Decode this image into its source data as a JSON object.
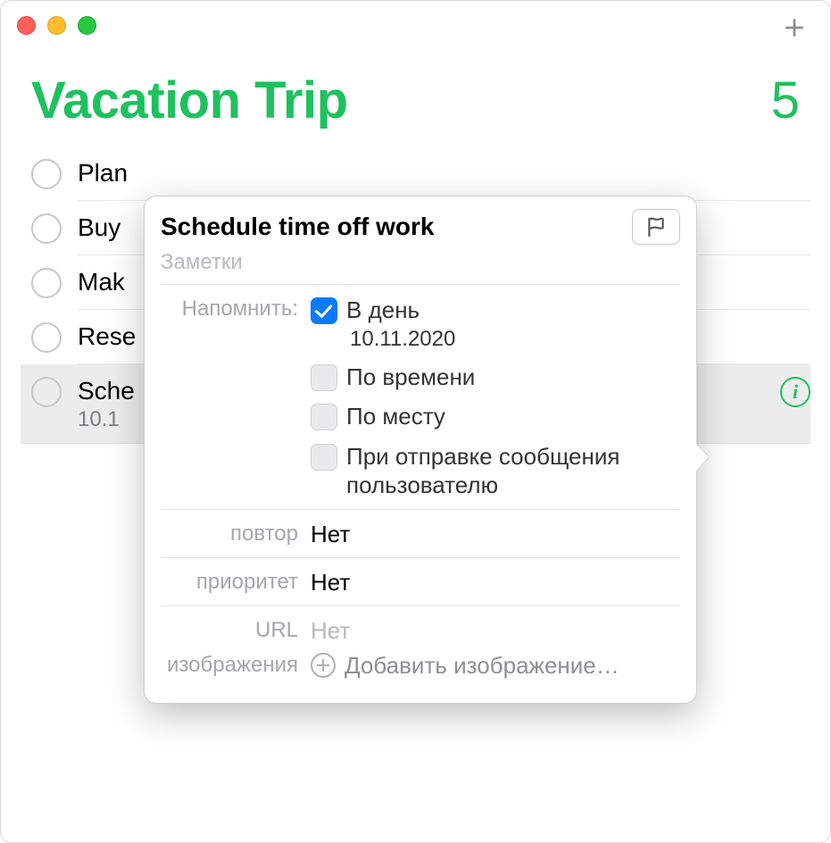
{
  "header": {
    "title": "Vacation Trip",
    "count": "5"
  },
  "reminders": {
    "items": [
      {
        "text": "Plan"
      },
      {
        "text": "Buy"
      },
      {
        "text": "Mak"
      },
      {
        "text": "Rese"
      },
      {
        "text": "Sche",
        "date": "10.1"
      }
    ]
  },
  "popover": {
    "title": "Schedule time off work",
    "notes_placeholder": "Заметки",
    "remind_label": "Напомнить:",
    "on_day_label": "В день",
    "on_day_date": "10.11.2020",
    "by_time_label": "По времени",
    "by_location_label": "По месту",
    "on_message_label": "При отправке сообщения пользователю",
    "repeat_label": "повтор",
    "repeat_value": "Нет",
    "priority_label": "приоритет",
    "priority_value": "Нет",
    "url_label": "URL",
    "url_placeholder": "Нет",
    "images_label": "изображения",
    "add_image_label": "Добавить изображение…"
  }
}
